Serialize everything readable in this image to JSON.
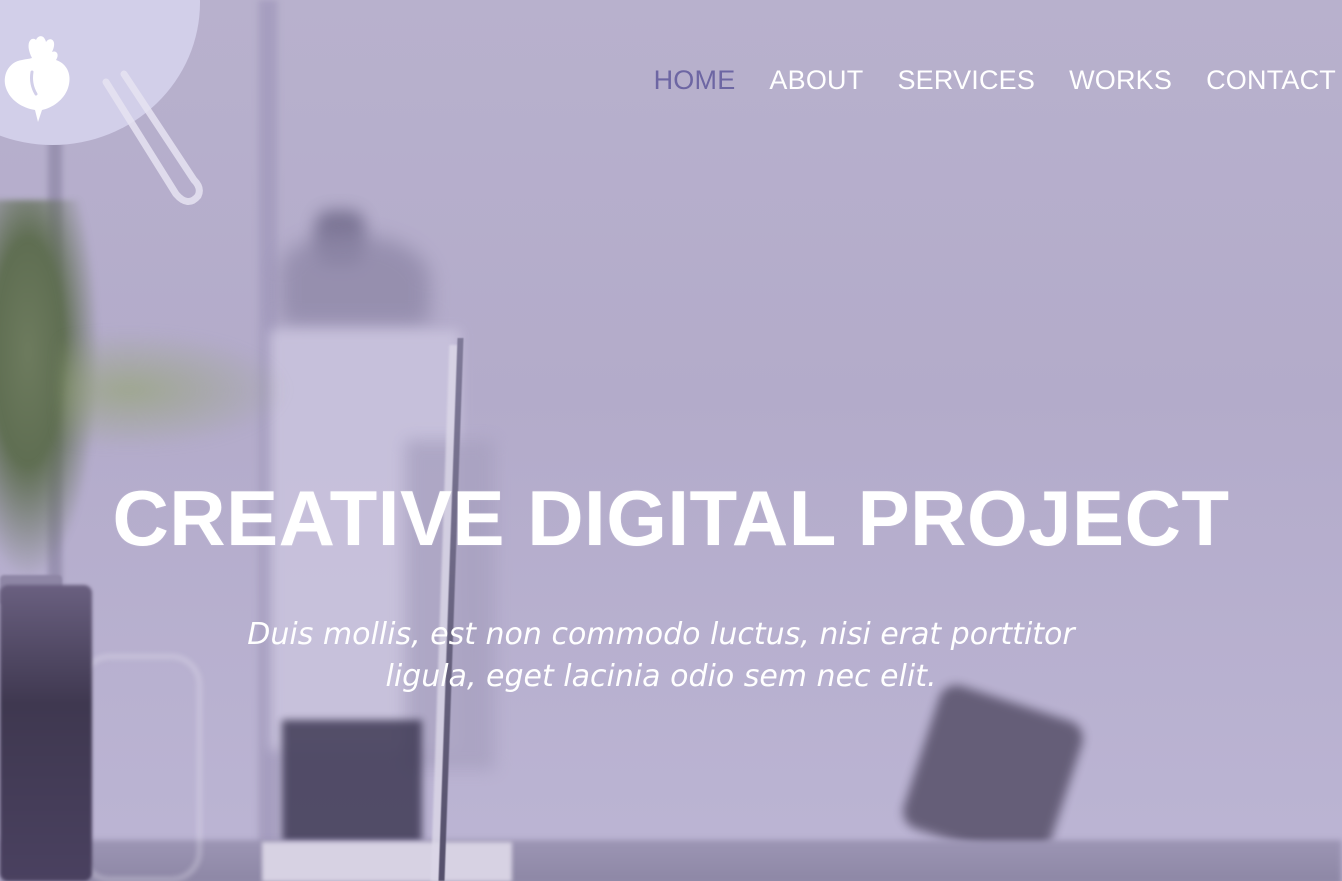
{
  "logo": {
    "icon": "beet-icon",
    "circle_color": "#d2cfe9"
  },
  "nav": {
    "items": [
      {
        "label": "HOME",
        "active": true
      },
      {
        "label": "ABOUT",
        "active": false
      },
      {
        "label": "SERVICES",
        "active": false
      },
      {
        "label": "WORKS",
        "active": false
      },
      {
        "label": "CONTACT",
        "active": false
      }
    ],
    "active_color": "#6d66a3",
    "text_color": "#ffffff"
  },
  "hero": {
    "title": "CREATIVE DIGITAL PROJECT",
    "subtitle_line1": "Duis mollis, est non commodo luctus, nisi erat porttitor",
    "subtitle_line2": "ligula, eget lacinia odio sem nec elit.",
    "overlay_color": "#b8b1cd"
  }
}
